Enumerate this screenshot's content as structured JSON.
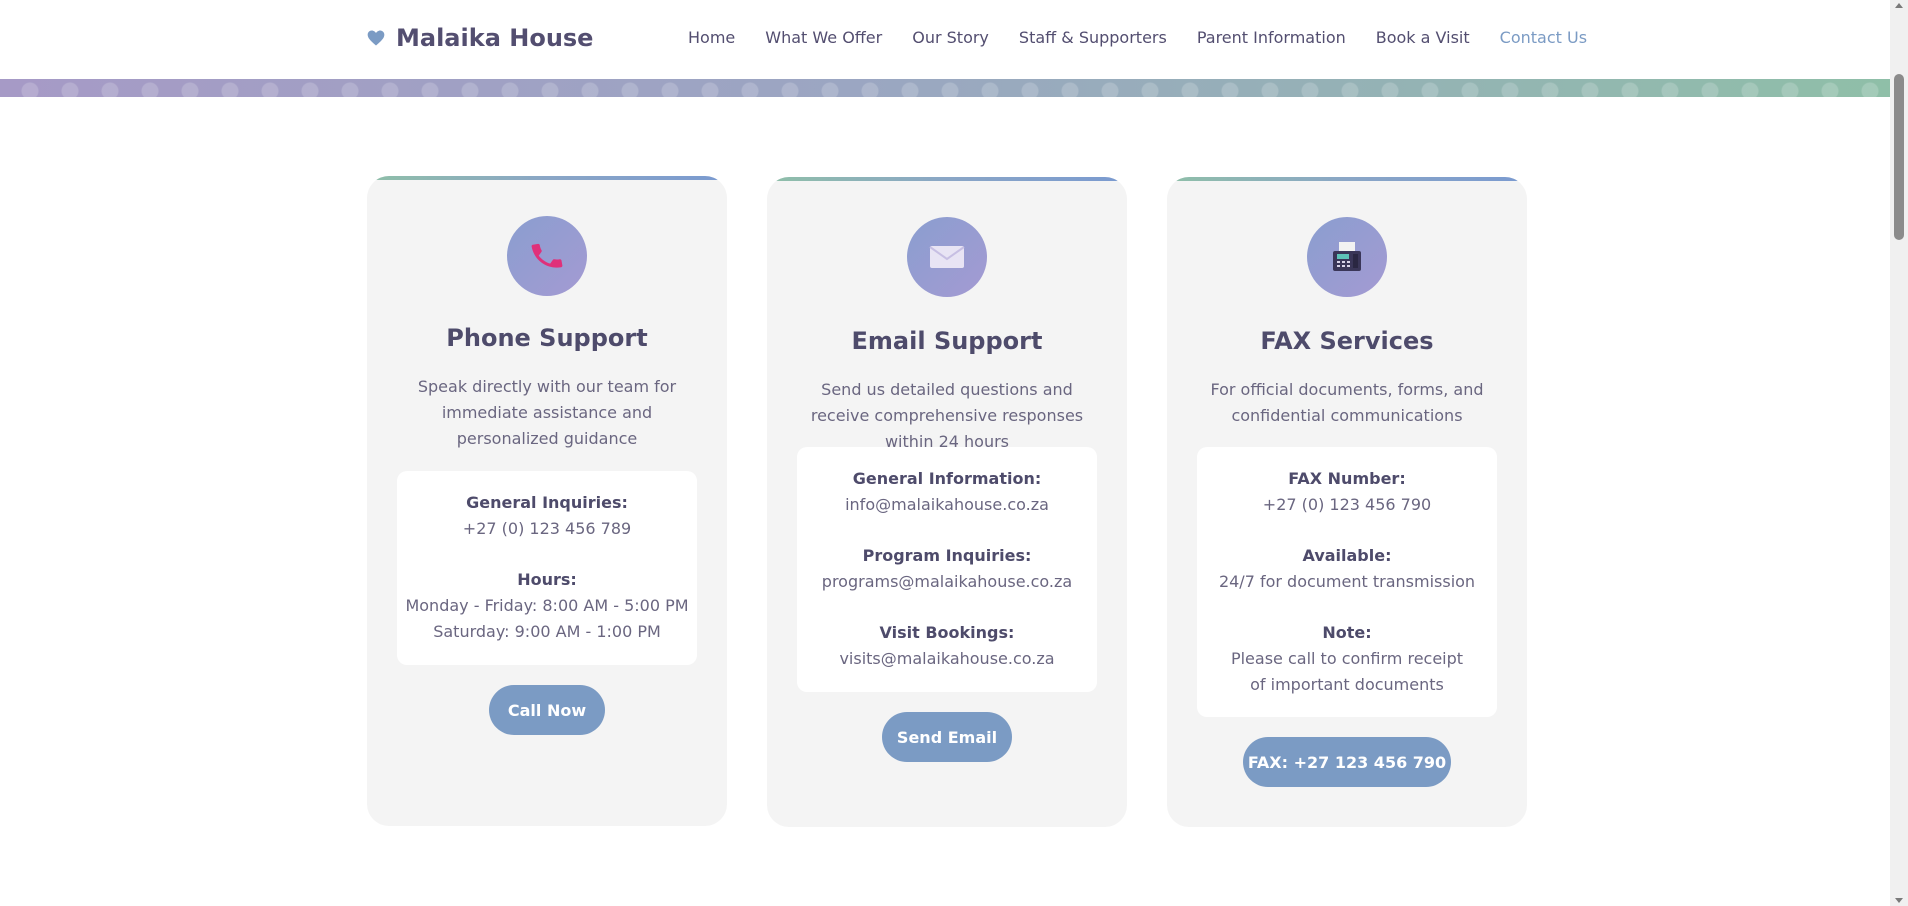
{
  "brand": {
    "name": "Malaika House",
    "icon": "heart-icon",
    "color": "#534e70"
  },
  "nav": {
    "items": [
      {
        "label": "Home"
      },
      {
        "label": "What We Offer"
      },
      {
        "label": "Our Story"
      },
      {
        "label": "Staff & Supporters"
      },
      {
        "label": "Parent Information"
      },
      {
        "label": "Book a Visit"
      },
      {
        "label": "Contact Us",
        "active": true
      }
    ]
  },
  "colors": {
    "accent": "#7b9bc4",
    "card_bg": "#f4f4f4",
    "heading": "#4e4b6b"
  },
  "cards": [
    {
      "icon": "phone-icon",
      "title": "Phone Support",
      "description": "Speak directly with our team for immediate assistance and personalized guidance",
      "info": [
        {
          "label": "General Inquiries:",
          "value": "+27 (0) 123 456 789"
        },
        {
          "label": "Hours:",
          "value": "Monday - Friday: 8:00 AM - 5:00 PM",
          "value2": "Saturday: 9:00 AM - 1:00 PM"
        }
      ],
      "button": "Call Now"
    },
    {
      "icon": "envelope-icon",
      "title": "Email Support",
      "description": "Send us detailed questions and receive comprehensive responses within 24 hours",
      "info": [
        {
          "label": "General Information:",
          "value": "info@malaikahouse.co.za"
        },
        {
          "label": "Program Inquiries:",
          "value": "programs@malaikahouse.co.za"
        },
        {
          "label": "Visit Bookings:",
          "value": "visits@malaikahouse.co.za"
        }
      ],
      "button": "Send Email"
    },
    {
      "icon": "fax-icon",
      "title": "FAX Services",
      "description": "For official documents, forms, and confidential communications",
      "info": [
        {
          "label": "FAX Number:",
          "value": "+27 (0) 123 456 790"
        },
        {
          "label": "Available:",
          "value": "24/7 for document transmission"
        },
        {
          "label": "Note:",
          "value": "Please call to confirm receipt of important documents"
        }
      ],
      "button": "FAX: +27 123 456 790"
    }
  ]
}
